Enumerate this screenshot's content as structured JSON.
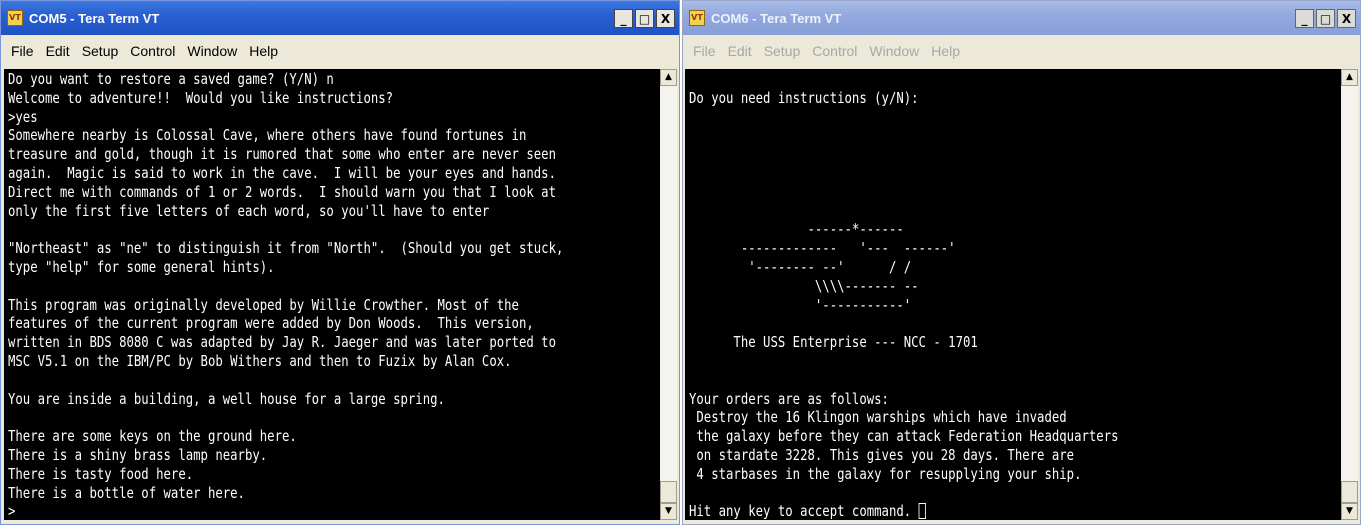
{
  "left_window": {
    "title": "COM5 - Tera Term VT",
    "icon": "tera-term-app-icon",
    "menu": [
      "File",
      "Edit",
      "Setup",
      "Control",
      "Window",
      "Help"
    ],
    "terminal_lines": [
      "Do you want to restore a saved game? (Y/N) n",
      "Welcome to adventure!!  Would you like instructions?",
      ">yes",
      "Somewhere nearby is Colossal Cave, where others have found fortunes in",
      "treasure and gold, though it is rumored that some who enter are never seen",
      "again.  Magic is said to work in the cave.  I will be your eyes and hands.",
      "Direct me with commands of 1 or 2 words.  I should warn you that I look at",
      "only the first five letters of each word, so you'll have to enter",
      "",
      "\"Northeast\" as \"ne\" to distinguish it from \"North\".  (Should you get stuck,",
      "type \"help\" for some general hints).",
      "",
      "This program was originally developed by Willie Crowther. Most of the",
      "features of the current program were added by Don Woods.  This version,",
      "written in BDS 8080 C was adapted by Jay R. Jaeger and was later ported to",
      "MSC V5.1 on the IBM/PC by Bob Withers and then to Fuzix by Alan Cox.",
      "",
      "You are inside a building, a well house for a large spring.",
      "",
      "There are some keys on the ground here.",
      "There is a shiny brass lamp nearby.",
      "There is tasty food here.",
      "There is a bottle of water here.",
      ">"
    ]
  },
  "right_window": {
    "title": "COM6 - Tera Term VT",
    "icon": "tera-term-app-icon",
    "menu": [
      "File",
      "Edit",
      "Setup",
      "Control",
      "Window",
      "Help"
    ],
    "terminal_lines": [
      "",
      "Do you need instructions (y/N):",
      "",
      "",
      "",
      "",
      "",
      "",
      "                ------*------",
      "       -------------   '---  ------'",
      "        '-------- --'      / /",
      "                 \\\\\\\\------- --",
      "                 '-----------'",
      "",
      "      The USS Enterprise --- NCC - 1701",
      "",
      "",
      "Your orders are as follows:",
      " Destroy the 16 Klingon warships which have invaded",
      " the galaxy before they can attack Federation Headquarters",
      " on stardate 3228. This gives you 28 days. There are",
      " 4 starbases in the galaxy for resupplying your ship.",
      "",
      "Hit any key to accept command. "
    ]
  },
  "window_controls": {
    "minimize": "_",
    "maximize": "□",
    "close": "X"
  },
  "scroll_arrows": {
    "up": "▲",
    "down": "▼"
  }
}
